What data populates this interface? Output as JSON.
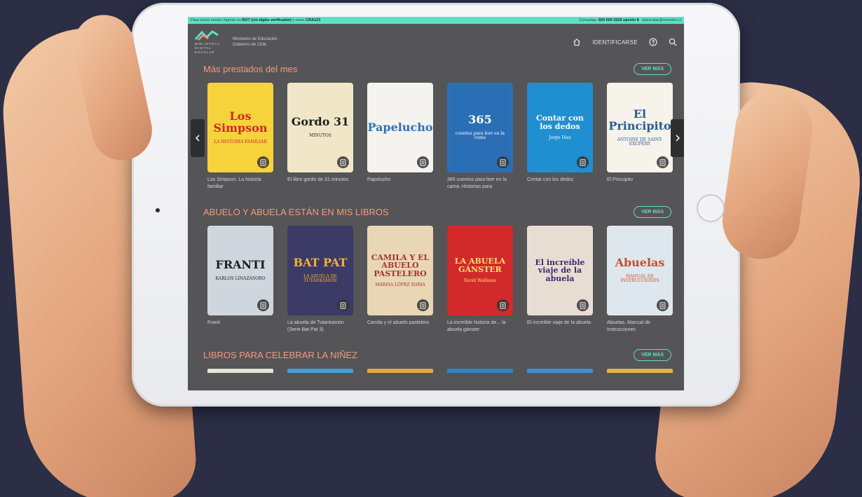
{
  "topbar": {
    "left_prefix": "Para iniciar sesión ingrese su",
    "left_rut": "RUT (sin dígito verificador)",
    "left_middle": "y clave",
    "left_clave": "CRA123",
    "right_consultas": "Consultas:",
    "right_phone": "600 600 2626 opción 8",
    "right_email": "bdescolar@mineduc.cl"
  },
  "header": {
    "logo_line1": "BIBLIOTECA",
    "logo_line2": "DIGITAL",
    "logo_line3": "ESCOLAR",
    "ministry_line1": "Ministerio de Educación",
    "ministry_line2": "Gobierno de Chile",
    "identify_label": "IDENTIFICARSE",
    "icons": [
      "home-icon",
      "help-icon",
      "search-icon"
    ]
  },
  "ver_mas_label": "VER MÁS",
  "sections": [
    {
      "title": "Más prestados del mes",
      "books": [
        {
          "title": "Los Simpson. La historia familiar",
          "cover_text": "Los Simpson",
          "cover_sub": "LA HISTORIA FAMILIAR",
          "bg": "#f6d33a",
          "fg": "#d1262a"
        },
        {
          "title": "El libro gordo de 31 minutos",
          "cover_text": "Gordo 31",
          "cover_sub": "MINUTOS",
          "bg": "#f1e6c8",
          "fg": "#1f1f1f"
        },
        {
          "title": "Papelucho",
          "cover_text": "Papelucho",
          "cover_sub": "",
          "bg": "#f4f3ef",
          "fg": "#2a74b8"
        },
        {
          "title": "365 cuentos para leer en la cama. Historias para",
          "cover_text": "365",
          "cover_sub": "cuentos para leer en la cama",
          "bg": "#2a6fb6",
          "fg": "#ffffff"
        },
        {
          "title": "Contar con los dedos",
          "cover_text": "Contar con los dedos",
          "cover_sub": "Jorge Díaz",
          "bg": "#1f8fd1",
          "fg": "#ffffff"
        },
        {
          "title": "El Principito",
          "cover_text": "El Principito",
          "cover_sub": "ANTOINE DE SAINT-EXUPÉRY",
          "bg": "#f5f3ea",
          "fg": "#2a5b9a"
        }
      ]
    },
    {
      "title": "ABUELO Y ABUELA ESTÁN EN MIS LIBROS",
      "books": [
        {
          "title": "Franti",
          "cover_text": "FRANTI",
          "cover_sub": "KARLOS LINAZASORO",
          "bg": "#cfd6de",
          "fg": "#1e1e1e"
        },
        {
          "title": "La abuela de Tutankamón (Serie Bat Pat 3)",
          "cover_text": "BAT PAT",
          "cover_sub": "LA ABUELA DE TUTANKAMÓN",
          "bg": "#3c3a66",
          "fg": "#f3b43a"
        },
        {
          "title": "Camila y el abuelo pastelero",
          "cover_text": "CAMILA Y EL ABUELO PASTELERO",
          "cover_sub": "MARISA LÓPEZ SORIA",
          "bg": "#e9d6b5",
          "fg": "#a3332c"
        },
        {
          "title": "La increíble historia de... la abuela gánster",
          "cover_text": "LA ABUELA GÁNSTER",
          "cover_sub": "David Walliams",
          "bg": "#d22a2a",
          "fg": "#ffe36a"
        },
        {
          "title": "El increíble viaje de la abuela",
          "cover_text": "El increíble viaje de la abuela",
          "cover_sub": "",
          "bg": "#e8ddd2",
          "fg": "#3a2c6b"
        },
        {
          "title": "Abuelas. Manual de instrucciones",
          "cover_text": "Abuelas",
          "cover_sub": "MANUAL DE INSTRUCCIONES",
          "bg": "#dfe7ee",
          "fg": "#c4502a"
        }
      ]
    },
    {
      "title": "LIBROS PARA CELEBRAR LA NIÑEZ",
      "peek_colors": [
        "#e9e4d6",
        "#3fa0d8",
        "#e8a54a",
        "#2c86c7",
        "#3e8fd6",
        "#e7b04a"
      ]
    }
  ],
  "colors": {
    "accent_teal": "#5fe0c2",
    "section_title": "#f39b7d",
    "screen_bg": "#555457"
  }
}
